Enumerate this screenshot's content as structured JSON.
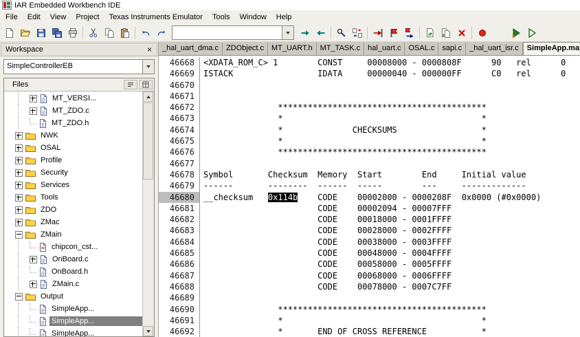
{
  "window": {
    "title": "IAR Embedded Workbench IDE"
  },
  "menu": {
    "items": [
      "File",
      "Edit",
      "View",
      "Project",
      "Texas Instruments Emulator",
      "Tools",
      "Window",
      "Help"
    ]
  },
  "toolbar": {
    "find_combo_value": "",
    "items": [
      {
        "type": "button",
        "icon": "new-document-icon"
      },
      {
        "type": "button",
        "icon": "open-file-icon"
      },
      {
        "type": "button",
        "icon": "save-icon"
      },
      {
        "type": "button",
        "icon": "save-all-icon"
      },
      {
        "type": "button",
        "icon": "print-icon"
      },
      {
        "type": "sep"
      },
      {
        "type": "button",
        "icon": "cut-icon"
      },
      {
        "type": "button",
        "icon": "copy-icon"
      },
      {
        "type": "button",
        "icon": "paste-icon"
      },
      {
        "type": "sep"
      },
      {
        "type": "button",
        "icon": "undo-icon"
      },
      {
        "type": "button",
        "icon": "redo-icon"
      },
      {
        "type": "combo"
      },
      {
        "type": "button",
        "icon": "find-next-icon"
      },
      {
        "type": "button",
        "icon": "find-previous-icon"
      },
      {
        "type": "sep"
      },
      {
        "type": "button",
        "icon": "find-in-files-icon"
      },
      {
        "type": "button",
        "icon": "replace-icon"
      },
      {
        "type": "sep"
      },
      {
        "type": "button",
        "icon": "goto-icon"
      },
      {
        "type": "button",
        "icon": "toggle-bookmark-icon"
      },
      {
        "type": "button",
        "icon": "next-bookmark-icon"
      },
      {
        "type": "sep"
      },
      {
        "type": "button",
        "icon": "compile-icon"
      },
      {
        "type": "button",
        "icon": "make-icon"
      },
      {
        "type": "button",
        "icon": "stop-build-icon"
      },
      {
        "type": "sep"
      },
      {
        "type": "button",
        "icon": "toggle-breakpoint-icon"
      },
      {
        "type": "gap"
      },
      {
        "type": "button",
        "icon": "download-debug-icon"
      },
      {
        "type": "button",
        "icon": "debug-without-download-icon"
      }
    ]
  },
  "workspace": {
    "title": "Workspace",
    "close_glyph": "×",
    "config_combo_value": "SimpleControllerEB",
    "files_header": "Files",
    "tree": [
      {
        "label": "MT_VERSI...",
        "level": 2,
        "expander": "+",
        "icon": "file-icon"
      },
      {
        "label": "MT_ZDO.c",
        "level": 2,
        "expander": "+",
        "icon": "file-icon"
      },
      {
        "label": "MT_ZDO.h",
        "level": 2,
        "expander": null,
        "icon": "file-icon"
      },
      {
        "label": "NWK",
        "level": 1,
        "expander": "+",
        "icon": "folder-icon"
      },
      {
        "label": "OSAL",
        "level": 1,
        "expander": "+",
        "icon": "folder-icon"
      },
      {
        "label": "Profile",
        "level": 1,
        "expander": "+",
        "icon": "folder-icon"
      },
      {
        "label": "Security",
        "level": 1,
        "expander": "+",
        "icon": "folder-icon"
      },
      {
        "label": "Services",
        "level": 1,
        "expander": "+",
        "icon": "folder-icon"
      },
      {
        "label": "Tools",
        "level": 1,
        "expander": "+",
        "icon": "folder-icon"
      },
      {
        "label": "ZDO",
        "level": 1,
        "expander": "+",
        "icon": "folder-icon"
      },
      {
        "label": "ZMac",
        "level": 1,
        "expander": "+",
        "icon": "folder-icon"
      },
      {
        "label": "ZMain",
        "level": 1,
        "expander": "-",
        "icon": "folder-icon"
      },
      {
        "label": "chipcon_cst...",
        "level": 2,
        "expander": null,
        "icon": "asm-file-icon"
      },
      {
        "label": "OnBoard.c",
        "level": 2,
        "expander": "+",
        "icon": "file-icon"
      },
      {
        "label": "OnBoard.h",
        "level": 2,
        "expander": null,
        "icon": "file-icon"
      },
      {
        "label": "ZMain.c",
        "level": 2,
        "expander": "+",
        "icon": "file-icon"
      },
      {
        "label": "Output",
        "level": 1,
        "expander": "-",
        "icon": "folder-icon"
      },
      {
        "label": "SimpleApp...",
        "level": 2,
        "expander": null,
        "icon": "file-icon"
      },
      {
        "label": "SimpleApp...",
        "level": 2,
        "expander": null,
        "icon": "file-icon",
        "selected": true
      },
      {
        "label": "SimpleApp...",
        "level": 2,
        "expander": null,
        "icon": "file-icon"
      }
    ]
  },
  "editor": {
    "tabs": [
      {
        "label": "_hal_uart_dma.c",
        "active": false
      },
      {
        "label": "ZDObject.c",
        "active": false
      },
      {
        "label": "MT_UART.h",
        "active": false
      },
      {
        "label": "MT_TASK.c",
        "active": false
      },
      {
        "label": "hal_uart.c",
        "active": false
      },
      {
        "label": "OSAL.c",
        "active": false
      },
      {
        "label": "sapi.c",
        "active": false
      },
      {
        "label": "_hal_uart_isr.c",
        "active": false
      },
      {
        "label": "SimpleApp.map",
        "active": true
      }
    ],
    "lines": [
      {
        "num": "46668",
        "segments": [
          {
            "text": "<XDATA_ROM_C> 1        CONST     00008000 - 0000808F      90   rel      0"
          }
        ]
      },
      {
        "num": "46669",
        "segments": [
          {
            "text": "ISTACK                 IDATA     00000040 - 000000FF      C0   rel      0"
          }
        ]
      },
      {
        "num": "46670",
        "segments": []
      },
      {
        "num": "46671",
        "segments": []
      },
      {
        "num": "46672",
        "segments": [
          {
            "text": "               ******************************************"
          }
        ]
      },
      {
        "num": "46673",
        "segments": [
          {
            "text": "               *                                        *"
          }
        ]
      },
      {
        "num": "46674",
        "segments": [
          {
            "text": "               *              CHECKSUMS                 *"
          }
        ]
      },
      {
        "num": "46675",
        "segments": [
          {
            "text": "               *                                        *"
          }
        ]
      },
      {
        "num": "46676",
        "segments": [
          {
            "text": "               ******************************************"
          }
        ]
      },
      {
        "num": "46677",
        "segments": []
      },
      {
        "num": "46678",
        "segments": [
          {
            "text": "Symbol       Checksum  Memory  Start        End     Initial value"
          }
        ]
      },
      {
        "num": "46679",
        "segments": [
          {
            "text": "------       --------  ------  -----        ---     -------------"
          }
        ]
      },
      {
        "num": "46680",
        "current": true,
        "segments": [
          {
            "text": "__checksum   "
          },
          {
            "text": "0x114b",
            "selected": true
          },
          {
            "text": "    CODE    00002000 - 0000208F  0x0000 (#0x0000)"
          }
        ]
      },
      {
        "num": "46681",
        "segments": [
          {
            "text": "                       CODE    00002094 - 00007FFF"
          }
        ]
      },
      {
        "num": "46682",
        "segments": [
          {
            "text": "                       CODE    00018000 - 0001FFFF"
          }
        ]
      },
      {
        "num": "46683",
        "segments": [
          {
            "text": "                       CODE    00028000 - 0002FFFF"
          }
        ]
      },
      {
        "num": "46684",
        "segments": [
          {
            "text": "                       CODE    00038000 - 0003FFFF"
          }
        ]
      },
      {
        "num": "46685",
        "segments": [
          {
            "text": "                       CODE    00048000 - 0004FFFF"
          }
        ]
      },
      {
        "num": "46686",
        "segments": [
          {
            "text": "                       CODE    00058000 - 0005FFFF"
          }
        ]
      },
      {
        "num": "46687",
        "segments": [
          {
            "text": "                       CODE    00068000 - 0006FFFF"
          }
        ]
      },
      {
        "num": "46688",
        "segments": [
          {
            "text": "                       CODE    00078000 - 0007C7FF"
          }
        ]
      },
      {
        "num": "46689",
        "segments": []
      },
      {
        "num": "46690",
        "segments": [
          {
            "text": "               ******************************************"
          }
        ]
      },
      {
        "num": "46691",
        "segments": [
          {
            "text": "               *                                        *"
          }
        ]
      },
      {
        "num": "46692",
        "segments": [
          {
            "text": "               *       END OF CROSS REFERENCE           *"
          }
        ]
      }
    ]
  },
  "colors": {
    "selection_bg": "#000000",
    "selection_fg": "#ffffff",
    "tree_selected_bg": "#7f7f7f",
    "current_line_gutter_bg": "#bdbdbd",
    "folder_icon": "#ffd24a"
  }
}
